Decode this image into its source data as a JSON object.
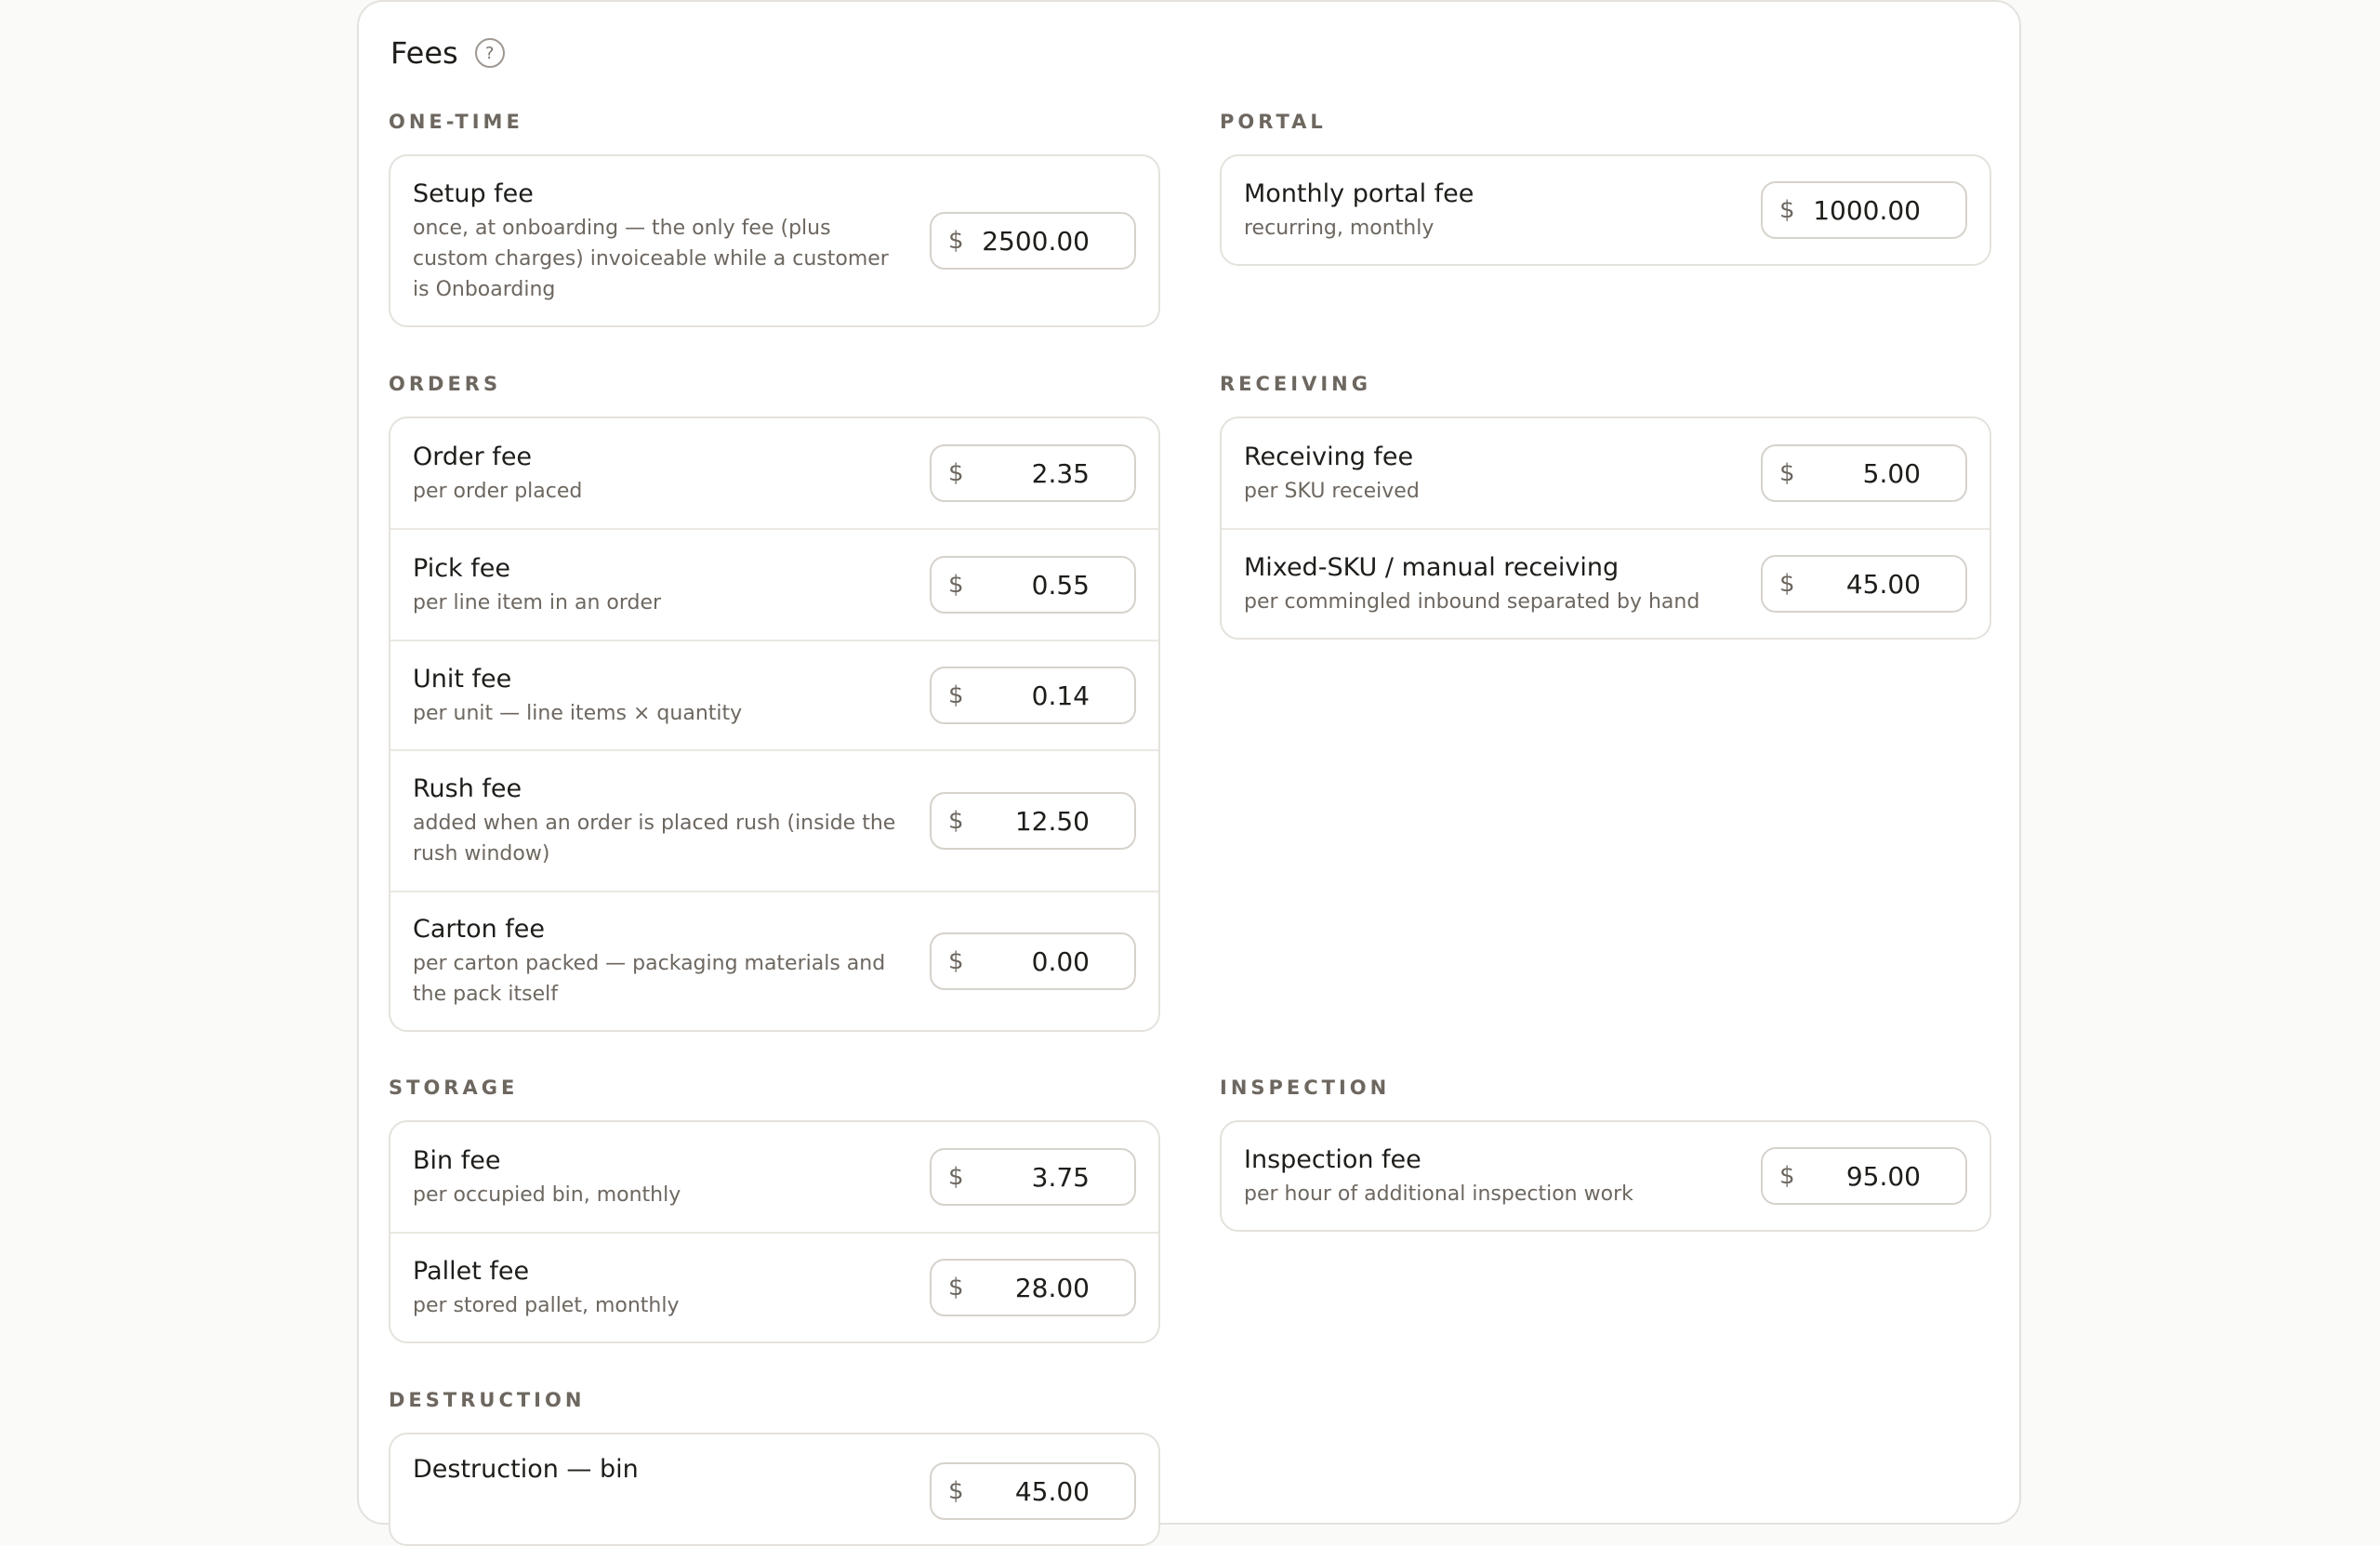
{
  "header": {
    "title": "Fees",
    "help": "?"
  },
  "currency": "$",
  "sections": {
    "one_time": {
      "title": "ONE-TIME",
      "rows": [
        {
          "label": "Setup fee",
          "desc": "once, at onboarding — the only fee (plus custom charges) invoiceable while a customer is Onboarding",
          "value": "2500.00"
        }
      ]
    },
    "portal": {
      "title": "PORTAL",
      "rows": [
        {
          "label": "Monthly portal fee",
          "desc": "recurring, monthly",
          "value": "1000.00"
        }
      ]
    },
    "orders": {
      "title": "ORDERS",
      "rows": [
        {
          "label": "Order fee",
          "desc": "per order placed",
          "value": "2.35"
        },
        {
          "label": "Pick fee",
          "desc": "per line item in an order",
          "value": "0.55"
        },
        {
          "label": "Unit fee",
          "desc": "per unit — line items × quantity",
          "value": "0.14"
        },
        {
          "label": "Rush fee",
          "desc": "added when an order is placed rush (inside the rush window)",
          "value": "12.50"
        },
        {
          "label": "Carton fee",
          "desc": "per carton packed — packaging materials and the pack itself",
          "value": "0.00"
        }
      ]
    },
    "receiving": {
      "title": "RECEIVING",
      "rows": [
        {
          "label": "Receiving fee",
          "desc": "per SKU received",
          "value": "5.00"
        },
        {
          "label": "Mixed-SKU / manual receiving",
          "desc": "per commingled inbound separated by hand",
          "value": "45.00"
        }
      ]
    },
    "storage": {
      "title": "STORAGE",
      "rows": [
        {
          "label": "Bin fee",
          "desc": "per occupied bin, monthly",
          "value": "3.75"
        },
        {
          "label": "Pallet fee",
          "desc": "per stored pallet, monthly",
          "value": "28.00"
        }
      ]
    },
    "inspection": {
      "title": "INSPECTION",
      "rows": [
        {
          "label": "Inspection fee",
          "desc": "per hour of additional inspection work",
          "value": "95.00"
        }
      ]
    },
    "destruction": {
      "title": "DESTRUCTION",
      "rows": [
        {
          "label": "Destruction — bin",
          "desc": "",
          "value": "45.00"
        }
      ]
    }
  }
}
